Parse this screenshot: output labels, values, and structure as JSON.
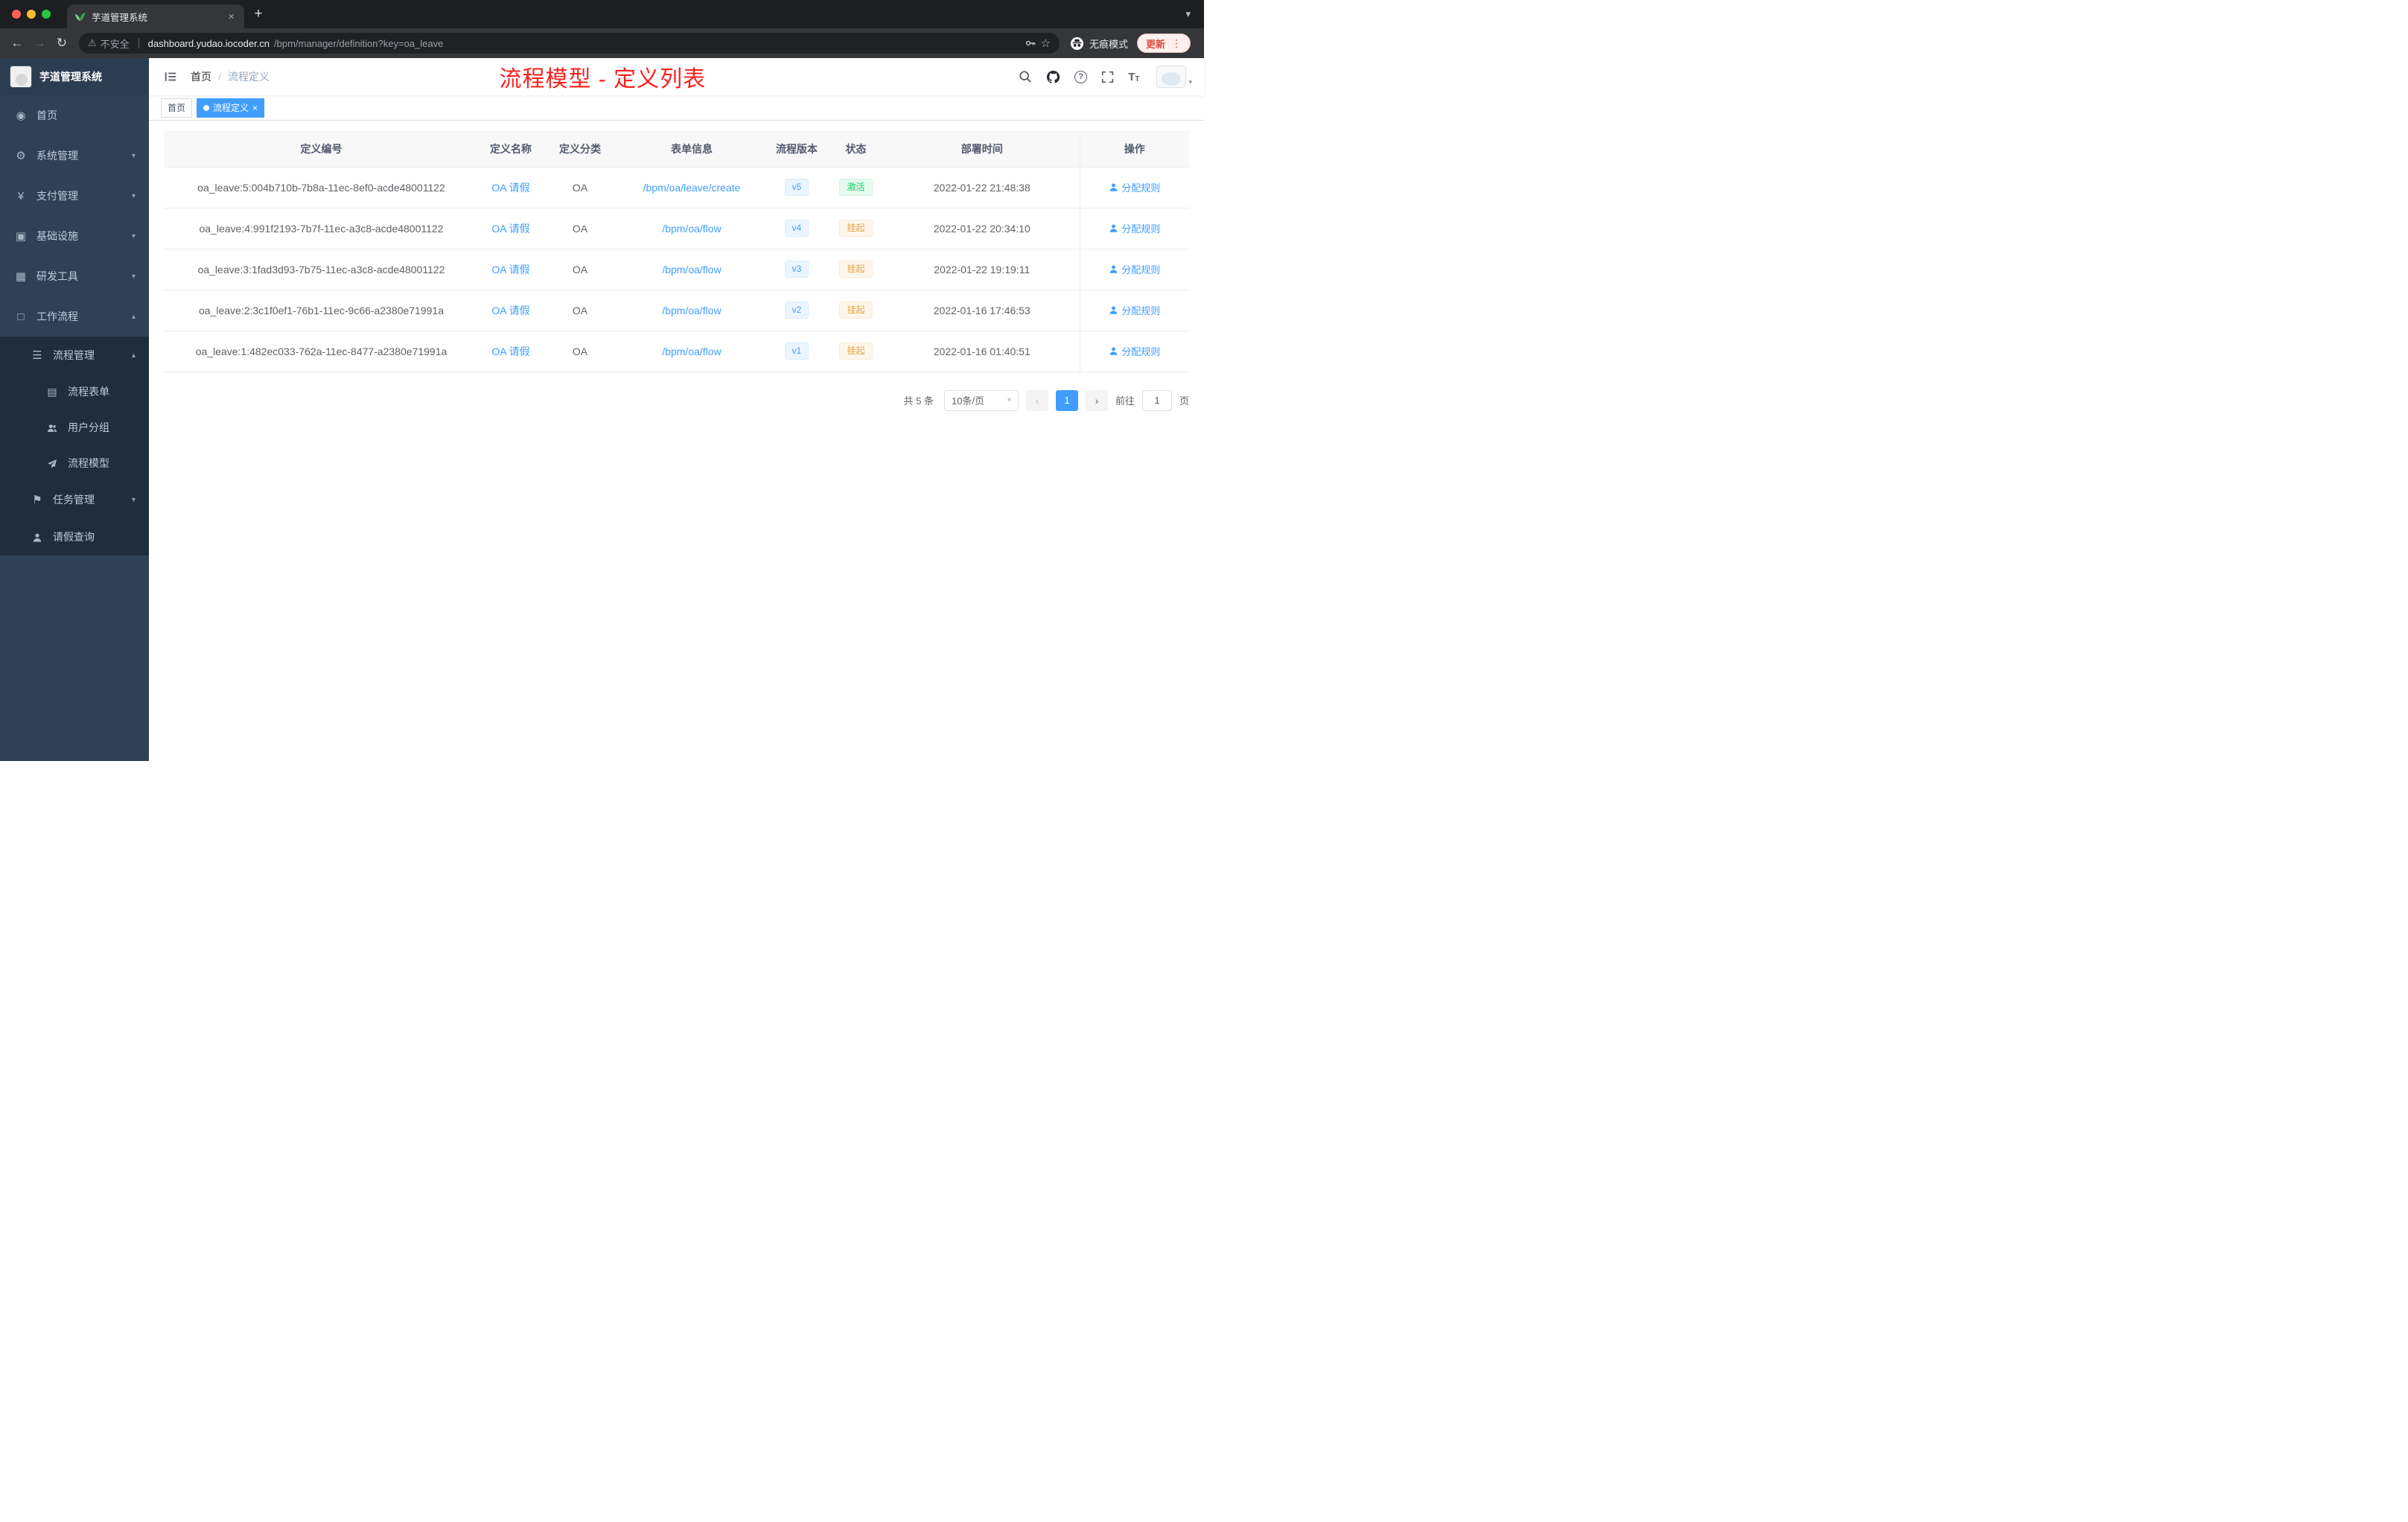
{
  "browser": {
    "tab_title": "芋道管理系统",
    "security_label": "不安全",
    "url_host": "dashboard.yudao.iocoder.cn",
    "url_path": "/bpm/manager/definition?key=oa_leave",
    "incognito_label": "无痕模式",
    "update_label": "更新"
  },
  "icons": {
    "back": "←",
    "forward": "→",
    "reload": "↻",
    "warning": "⚠",
    "star": "☆",
    "plus": "+",
    "close": "×",
    "kebab": "⋮",
    "chevron_down": "▾",
    "chevron_up": "▴",
    "tab_caret": "▾",
    "dashboard": "◉",
    "gear": "⚙",
    "yen": "¥",
    "infra": "▣",
    "tools": "▦",
    "workflow": "□",
    "list": "☰",
    "form": "▤",
    "flag": "⚑",
    "question": "?",
    "font_large": "T",
    "font_small": "T",
    "slash": "/",
    "prev": "‹",
    "next": "›",
    "select_caret": "▾"
  },
  "sidebar": {
    "logo_title": "芋道管理系统",
    "items": [
      {
        "label": "首页"
      },
      {
        "label": "系统管理"
      },
      {
        "label": "支付管理"
      },
      {
        "label": "基础设施"
      },
      {
        "label": "研发工具"
      },
      {
        "label": "工作流程"
      }
    ],
    "process_group": {
      "label": "流程管理"
    },
    "process_children": [
      {
        "label": "流程表单"
      },
      {
        "label": "用户分组"
      },
      {
        "label": "流程模型"
      }
    ],
    "task_group": {
      "label": "任务管理"
    },
    "leave_item": {
      "label": "请假查询"
    }
  },
  "header": {
    "breadcrumb": {
      "home": "首页",
      "current": "流程定义"
    },
    "annotation": "流程模型 - 定义列表"
  },
  "tags_bar": {
    "home": "首页",
    "active": "流程定义"
  },
  "table": {
    "columns": {
      "id": "定义编号",
      "name": "定义名称",
      "category": "定义分类",
      "form": "表单信息",
      "version": "流程版本",
      "status": "状态",
      "time": "部署时间",
      "ops": "操作"
    },
    "rows": [
      {
        "id": "oa_leave:5:004b710b-7b8a-11ec-8ef0-acde48001122",
        "name": "OA 请假",
        "category": "OA",
        "form": "/bpm/oa/leave/create",
        "version": "v5",
        "status": "激活",
        "time": "2022-01-22 21:48:38",
        "action": "分配规则"
      },
      {
        "id": "oa_leave:4:991f2193-7b7f-11ec-a3c8-acde48001122",
        "name": "OA 请假",
        "category": "OA",
        "form": "/bpm/oa/flow",
        "version": "v4",
        "status": "挂起",
        "time": "2022-01-22 20:34:10",
        "action": "分配规则"
      },
      {
        "id": "oa_leave:3:1fad3d93-7b75-11ec-a3c8-acde48001122",
        "name": "OA 请假",
        "category": "OA",
        "form": "/bpm/oa/flow",
        "version": "v3",
        "status": "挂起",
        "time": "2022-01-22 19:19:11",
        "action": "分配规则"
      },
      {
        "id": "oa_leave:2:3c1f0ef1-76b1-11ec-9c66-a2380e71991a",
        "name": "OA 请假",
        "category": "OA",
        "form": "/bpm/oa/flow",
        "version": "v2",
        "status": "挂起",
        "time": "2022-01-16 17:46:53",
        "action": "分配规则"
      },
      {
        "id": "oa_leave:1:482ec033-762a-11ec-8477-a2380e71991a",
        "name": "OA 请假",
        "category": "OA",
        "form": "/bpm/oa/flow",
        "version": "v1",
        "status": "挂起",
        "time": "2022-01-16 01:40:51",
        "action": "分配规则"
      }
    ]
  },
  "pagination": {
    "total": "共 5 条",
    "page_size": "10条/页",
    "page": "1",
    "goto_label": "前往",
    "goto_value": "1",
    "unit": "页"
  },
  "colors": {
    "accent": "#409eff",
    "success": "#13ce66",
    "warning": "#e6a23c",
    "annotation_red": "#fb1f1f",
    "sidebar_bg": "#304156",
    "submenu_bg": "#1f2d3d"
  }
}
